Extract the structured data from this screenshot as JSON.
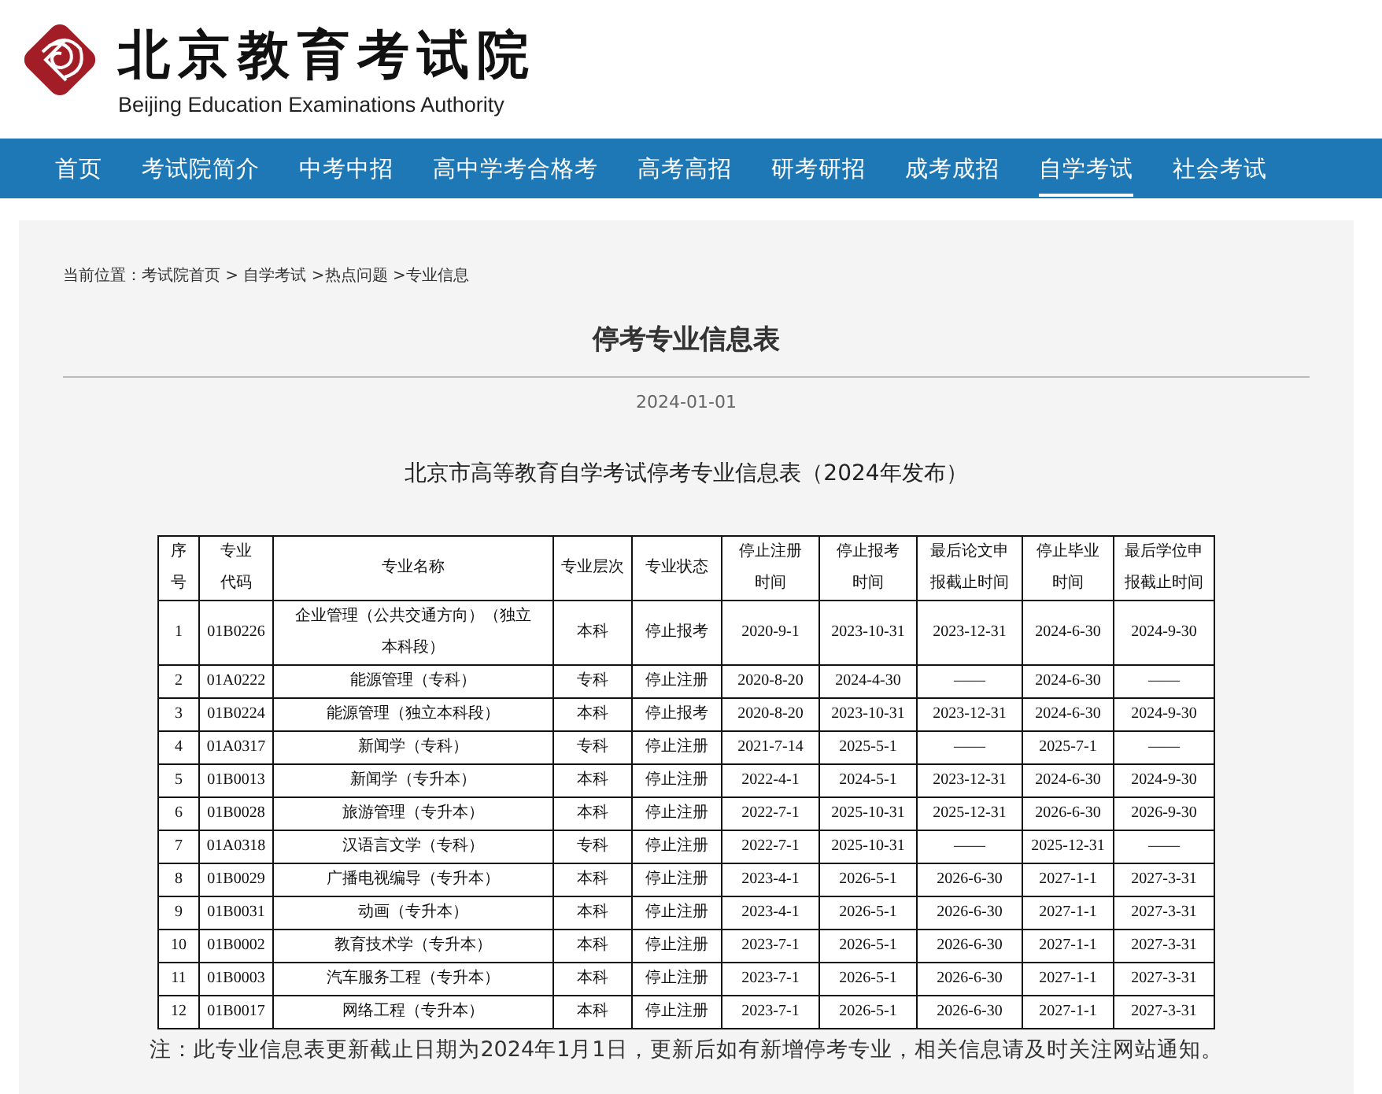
{
  "header": {
    "title": "北京教育考试院",
    "subtitle": "Beijing Education Examinations Authority"
  },
  "nav": [
    {
      "label": "首页",
      "selected": false
    },
    {
      "label": "考试院简介",
      "selected": false
    },
    {
      "label": "中考中招",
      "selected": false
    },
    {
      "label": "高中学考合格考",
      "selected": false
    },
    {
      "label": "高考高招",
      "selected": false
    },
    {
      "label": "研考研招",
      "selected": false
    },
    {
      "label": "成考成招",
      "selected": false
    },
    {
      "label": "自学考试",
      "selected": true
    },
    {
      "label": "社会考试",
      "selected": false
    }
  ],
  "breadcrumb": "当前位置：考试院首页 > 自学考试 >热点问题 >专业信息",
  "article": {
    "title": "停考专业信息表",
    "date": "2024-01-01",
    "subtitle": "北京市高等教育自学考试停考专业信息表（2024年发布）"
  },
  "table": {
    "columns": [
      "序号",
      "专业代码",
      "专业名称",
      "专业层次",
      "专业状态",
      "停止注册时间",
      "停止报考时间",
      "最后论文申报截止时间",
      "停止毕业时间",
      "最后学位申报截止时间"
    ],
    "rows": [
      [
        "1",
        "01B0226",
        "企业管理（公共交通方向）（独立本科段）",
        "本科",
        "停止报考",
        "2020-9-1",
        "2023-10-31",
        "2023-12-31",
        "2024-6-30",
        "2024-9-30"
      ],
      [
        "2",
        "01A0222",
        "能源管理（专科）",
        "专科",
        "停止注册",
        "2020-8-20",
        "2024-4-30",
        "——",
        "2024-6-30",
        "——"
      ],
      [
        "3",
        "01B0224",
        "能源管理（独立本科段）",
        "本科",
        "停止报考",
        "2020-8-20",
        "2023-10-31",
        "2023-12-31",
        "2024-6-30",
        "2024-9-30"
      ],
      [
        "4",
        "01A0317",
        "新闻学（专科）",
        "专科",
        "停止注册",
        "2021-7-14",
        "2025-5-1",
        "——",
        "2025-7-1",
        "——"
      ],
      [
        "5",
        "01B0013",
        "新闻学（专升本）",
        "本科",
        "停止注册",
        "2022-4-1",
        "2024-5-1",
        "2023-12-31",
        "2024-6-30",
        "2024-9-30"
      ],
      [
        "6",
        "01B0028",
        "旅游管理（专升本）",
        "本科",
        "停止注册",
        "2022-7-1",
        "2025-10-31",
        "2025-12-31",
        "2026-6-30",
        "2026-9-30"
      ],
      [
        "7",
        "01A0318",
        "汉语言文学（专科）",
        "专科",
        "停止注册",
        "2022-7-1",
        "2025-10-31",
        "——",
        "2025-12-31",
        "——"
      ],
      [
        "8",
        "01B0029",
        "广播电视编导（专升本）",
        "本科",
        "停止注册",
        "2023-4-1",
        "2026-5-1",
        "2026-6-30",
        "2027-1-1",
        "2027-3-31"
      ],
      [
        "9",
        "01B0031",
        "动画（专升本）",
        "本科",
        "停止注册",
        "2023-4-1",
        "2026-5-1",
        "2026-6-30",
        "2027-1-1",
        "2027-3-31"
      ],
      [
        "10",
        "01B0002",
        "教育技术学（专升本）",
        "本科",
        "停止注册",
        "2023-7-1",
        "2026-5-1",
        "2026-6-30",
        "2027-1-1",
        "2027-3-31"
      ],
      [
        "11",
        "01B0003",
        "汽车服务工程（专升本）",
        "本科",
        "停止注册",
        "2023-7-1",
        "2026-5-1",
        "2026-6-30",
        "2027-1-1",
        "2027-3-31"
      ],
      [
        "12",
        "01B0017",
        "网络工程（专升本）",
        "本科",
        "停止注册",
        "2023-7-1",
        "2026-5-1",
        "2026-6-30",
        "2027-1-1",
        "2027-3-31"
      ]
    ]
  },
  "note": "注：此专业信息表更新截止日期为2024年1月1日，更新后如有新增停考专业，相关信息请及时关注网站通知。"
}
